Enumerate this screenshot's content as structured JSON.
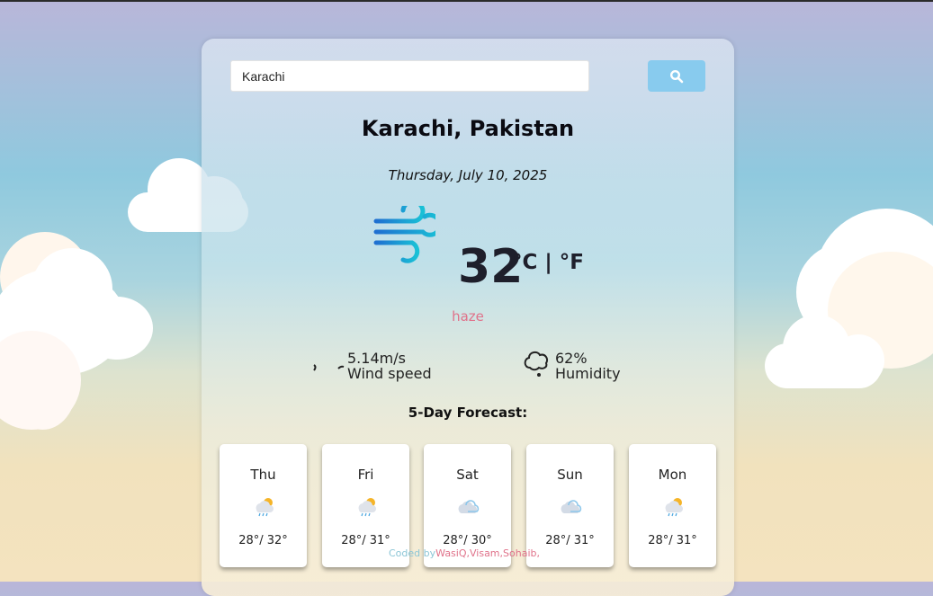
{
  "search": {
    "value": "Karachi",
    "button_icon": "search-icon"
  },
  "location": "Karachi, Pakistan",
  "date": "Thursday, July 10, 2025",
  "current": {
    "icon": "wind-icon",
    "temperature": "32",
    "units": "°C | °F",
    "condition": "haze"
  },
  "stats": {
    "wind": {
      "value": "5.14m/s",
      "label": "Wind speed"
    },
    "humidity": {
      "value": "62%",
      "label": "Humidity"
    }
  },
  "forecast": {
    "title": "5-Day Forecast:",
    "days": [
      {
        "day": "Thu",
        "icon": "sun-rain-cloud-icon",
        "low": "28°/",
        "high": "32°"
      },
      {
        "day": "Fri",
        "icon": "sun-rain-cloud-icon",
        "low": "28°/",
        "high": "31°"
      },
      {
        "day": "Sat",
        "icon": "cloud-icon",
        "low": "28°/",
        "high": "30°"
      },
      {
        "day": "Sun",
        "icon": "cloud-icon",
        "low": "28°/",
        "high": "31°"
      },
      {
        "day": "Mon",
        "icon": "sun-rain-cloud-icon",
        "low": "28°/",
        "high": "31°"
      }
    ]
  },
  "credit": {
    "prefix": "Coded by",
    "names": "WasiQ,Visam,Sohaib,"
  },
  "colors": {
    "accent": "#88cbee",
    "condition": "#e0728a",
    "card": "#ffffff"
  }
}
